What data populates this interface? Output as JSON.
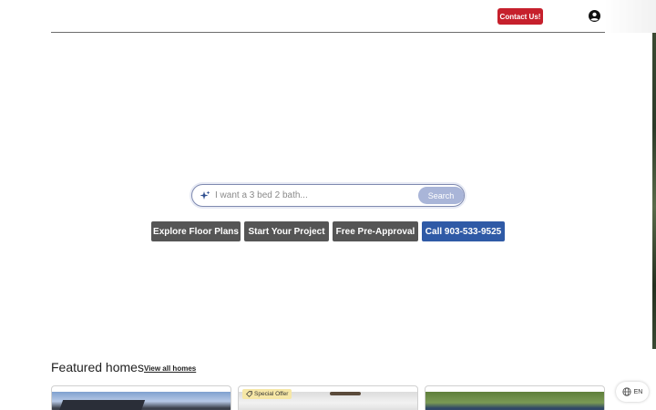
{
  "header": {
    "contact_label": "Contact Us!",
    "account_icon": "account-circle-icon"
  },
  "search": {
    "placeholder": "I want a 3 bed 2 bath...",
    "value": "",
    "button_label": "Search",
    "icon": "sparkle-icon"
  },
  "actions": [
    {
      "label": "Explore Floor Plans",
      "style": "gray"
    },
    {
      "label": "Start Your Project",
      "style": "gray"
    },
    {
      "label": "Free Pre-Approval",
      "style": "gray"
    },
    {
      "label": "Call 903-533-9525",
      "style": "blue"
    }
  ],
  "featured": {
    "title": "Featured homes",
    "view_all_label": "View all homes",
    "cards": [
      {
        "badge": ""
      },
      {
        "badge": "Special Offer",
        "badge_icon": "tag-icon"
      },
      {
        "badge": ""
      }
    ]
  },
  "language": {
    "label": "EN",
    "icon": "globe-icon"
  },
  "colors": {
    "contact_button": "#c6202c",
    "action_gray": "#555555",
    "action_blue": "#2f5aa6",
    "search_button": "#a9b5d8",
    "badge": "#f6e7a6"
  }
}
